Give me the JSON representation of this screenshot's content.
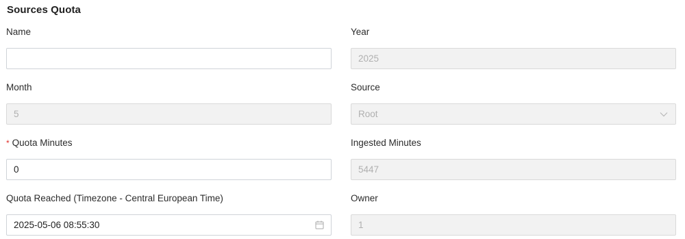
{
  "form": {
    "title": "Sources Quota",
    "name": {
      "label": "Name",
      "value": ""
    },
    "year": {
      "label": "Year",
      "value": "2025"
    },
    "month": {
      "label": "Month",
      "value": "5"
    },
    "source": {
      "label": "Source",
      "value": "Root",
      "icon": "chevron-down-icon"
    },
    "quota_minutes": {
      "required_mark": "*",
      "label": "Quota Minutes",
      "value": "0"
    },
    "ingested_minutes": {
      "label": "Ingested Minutes",
      "value": "5447"
    },
    "quota_reached": {
      "label": "Quota Reached (Timezone - Central European Time)",
      "value": "2025-05-06 08:55:30",
      "icon": "calendar-icon"
    },
    "owner": {
      "label": "Owner",
      "value": "1"
    }
  },
  "colors": {
    "required": "#e0302a",
    "disabled_bg": "#f2f2f2",
    "border": "#cfd3d8"
  }
}
